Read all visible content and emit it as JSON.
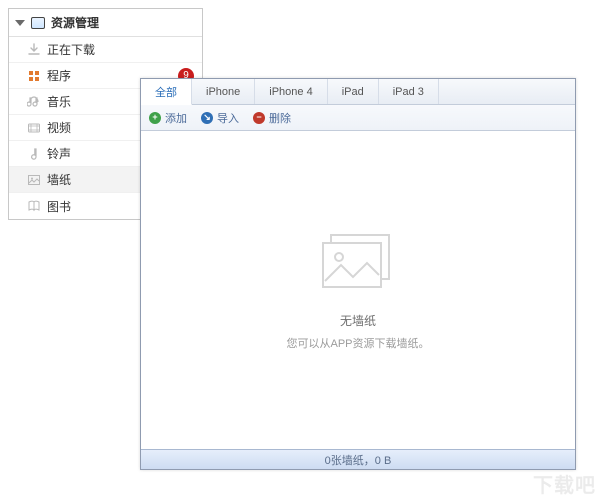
{
  "sidebar": {
    "title": "资源管理",
    "items": [
      {
        "label": "正在下载",
        "icon": "download"
      },
      {
        "label": "程序",
        "icon": "app",
        "badge": "9"
      },
      {
        "label": "音乐",
        "icon": "music"
      },
      {
        "label": "视频",
        "icon": "video"
      },
      {
        "label": "铃声",
        "icon": "ringtone"
      },
      {
        "label": "墙纸",
        "icon": "wallpaper",
        "selected": true
      },
      {
        "label": "图书",
        "icon": "book"
      }
    ]
  },
  "main": {
    "tabs": [
      {
        "label": "全部",
        "active": true
      },
      {
        "label": "iPhone"
      },
      {
        "label": "iPhone 4"
      },
      {
        "label": "iPad"
      },
      {
        "label": "iPad 3"
      }
    ],
    "toolbar": {
      "add": "添加",
      "import": "导入",
      "delete": "删除"
    },
    "empty": {
      "title": "无墙纸",
      "subtitle": "您可以从APP资源下载墙纸。"
    },
    "status": "0张墙纸，0 B"
  },
  "watermark": "下载吧"
}
